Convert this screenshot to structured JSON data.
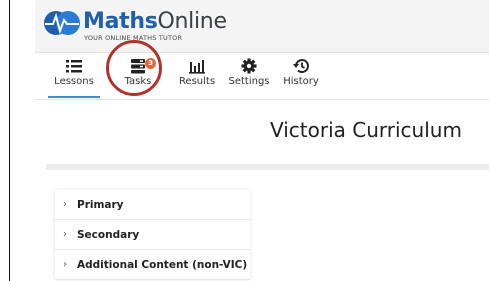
{
  "brand": {
    "name_part1": "Maths",
    "name_part2": "Online",
    "tagline": "YOUR ONLINE MATHS TUTOR"
  },
  "nav": {
    "items": [
      {
        "label": "Lessons",
        "icon": "list-icon",
        "active": true
      },
      {
        "label": "Tasks",
        "icon": "tasks-icon",
        "badge": "3"
      },
      {
        "label": "Results",
        "icon": "bar-chart-icon"
      },
      {
        "label": "Settings",
        "icon": "gear-icon"
      },
      {
        "label": "History",
        "icon": "history-icon"
      }
    ]
  },
  "main": {
    "title": "Victoria Curriculum",
    "sections": [
      {
        "label": "Primary"
      },
      {
        "label": "Secondary"
      },
      {
        "label": "Additional Content (non-VIC)"
      }
    ]
  },
  "colors": {
    "brand_blue": "#1f5fae",
    "badge": "#e5683a",
    "annotation_circle": "#b0332a",
    "active_tab": "#3b8fd9"
  }
}
